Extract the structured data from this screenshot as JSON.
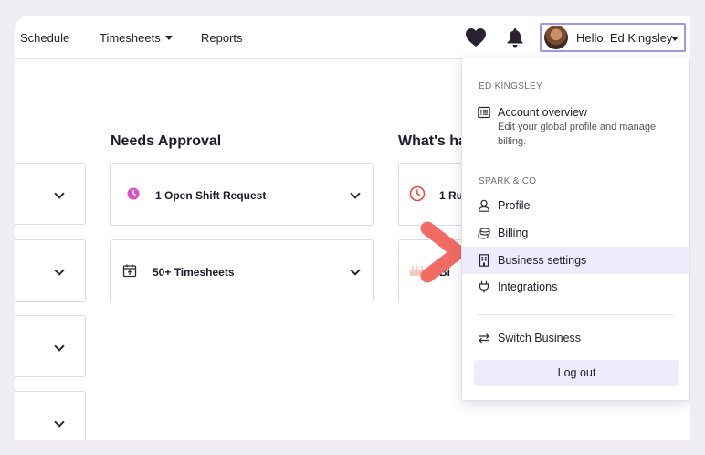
{
  "nav": {
    "schedule": "Schedule",
    "timesheets": "Timesheets",
    "reports": "Reports"
  },
  "user_button": {
    "label": "Hello, Ed Kingsley"
  },
  "icons": {
    "favorites": "heart-icon",
    "notifications": "bell-icon",
    "open_shift": "clock-icon",
    "timesheets": "calendar-upload-icon"
  },
  "sections": {
    "needs_approval": "Needs Approval",
    "whats_happening": "What's ha"
  },
  "cards": {
    "open_shift": "1 Open Shift Request",
    "timesheets": "50+ Timesheets",
    "running": "1 Ru",
    "birthday": "Bi"
  },
  "dropdown": {
    "user_header": "ED KINGSLEY",
    "account_overview": {
      "label": "Account overview",
      "desc": "Edit your global profile and manage billing."
    },
    "business_header": "SPARK & CO",
    "items": [
      {
        "label": "Profile",
        "icon": "person-icon"
      },
      {
        "label": "Billing",
        "icon": "coins-icon"
      },
      {
        "label": "Business settings",
        "icon": "building-icon"
      },
      {
        "label": "Integrations",
        "icon": "plug-icon"
      }
    ],
    "switch_business": "Switch Business",
    "logout": "Log out"
  },
  "colors": {
    "accent": "#a396e8",
    "active_bg": "#eeebfb",
    "arrow": "#f26b63",
    "clock": "#d94fc8",
    "warning": "#e0503c"
  }
}
